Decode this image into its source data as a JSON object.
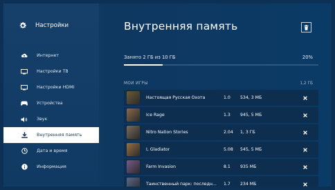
{
  "sidebar": {
    "title": "Настройки",
    "items": [
      {
        "label": "Интернет",
        "icon": "cloud-icon"
      },
      {
        "label": "Настройки ТВ",
        "icon": "tv-icon"
      },
      {
        "label": "Настройки HDMI",
        "icon": "hdmi-icon"
      },
      {
        "label": "Устройства",
        "icon": "gamepad-icon"
      },
      {
        "label": "Звук",
        "icon": "speaker-icon"
      },
      {
        "label": "Внутренняя память",
        "icon": "download-icon",
        "active": true
      },
      {
        "label": "Дата и время",
        "icon": "clock-icon"
      },
      {
        "label": "Информация",
        "icon": "info-icon"
      }
    ]
  },
  "main": {
    "title": "Внутренняя память",
    "usage_text": "Занято 2 ГБ из 10 ГБ",
    "usage_percent": "20%",
    "usage_fraction": 0.2,
    "section_title": "МОИ ИГРЫ",
    "section_size": "1,2 ГБ",
    "games": [
      {
        "name": "Настоящая Русская Охота",
        "version": "1.0",
        "size": "534, 3 МБ",
        "thumb_color": "#6b5a3a"
      },
      {
        "name": "Ice Rage",
        "version": "1.3",
        "size": "945, 5 МБ",
        "thumb_color": "#8a6b4a"
      },
      {
        "name": "Nitro Nation Stories",
        "version": "2.04",
        "size": "1, 3 ГБ",
        "thumb_color": "#7a6a5a"
      },
      {
        "name": "I, Gladiator",
        "version": "5.08",
        "size": "545, 5 МБ",
        "thumb_color": "#9a7040"
      },
      {
        "name": "Farm Invasion",
        "version": "8.1",
        "size": "935 МБ",
        "thumb_color": "#7a5a8a"
      },
      {
        "name": "Таинственный парк: последн...",
        "version": "1.7",
        "size": "234 МБ",
        "thumb_color": "#5a6a8a"
      }
    ]
  },
  "colors": {
    "background": "#0d3154",
    "row": "#0e2e4f",
    "active_item_bg": "#ffffff",
    "active_item_text": "#12375b"
  }
}
